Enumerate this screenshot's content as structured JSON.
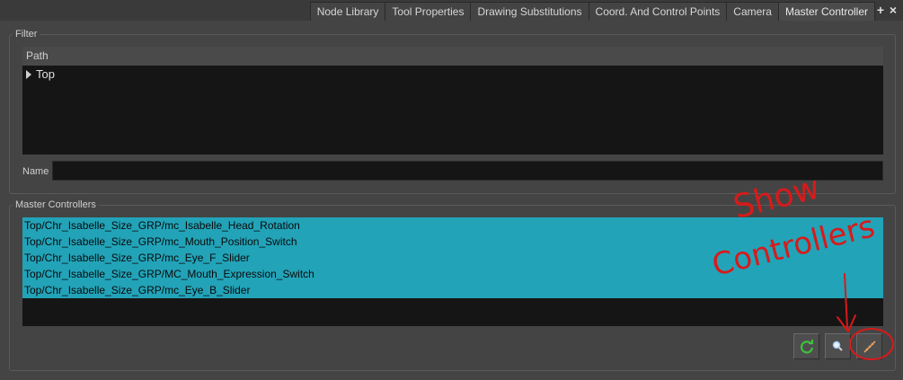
{
  "tabs": [
    {
      "label": "Node Library"
    },
    {
      "label": "Tool Properties"
    },
    {
      "label": "Drawing Substitutions"
    },
    {
      "label": "Coord. And Control Points"
    },
    {
      "label": "Camera"
    },
    {
      "label": "Master Controller",
      "active": true
    }
  ],
  "tab_controls": {
    "add_icon": "plus-icon",
    "close_icon": "close-icon"
  },
  "filter": {
    "title": "Filter",
    "tree_header": "Path",
    "tree_root": "Top",
    "name_label": "Name",
    "name_value": ""
  },
  "master_controllers": {
    "title": "Master Controllers",
    "items": [
      "Top/Chr_Isabelle_Size_GRP/mc_Isabelle_Head_Rotation",
      "Top/Chr_Isabelle_Size_GRP/mc_Mouth_Position_Switch",
      "Top/Chr_Isabelle_Size_GRP/mc_Eye_F_Slider",
      "Top/Chr_Isabelle_Size_GRP/MC_Mouth_Expression_Switch",
      "Top/Chr_Isabelle_Size_GRP/mc_Eye_B_Slider"
    ]
  },
  "toolbar": {
    "refresh_icon": "refresh-icon",
    "search_icon": "magnifier-icon",
    "show_controllers_icon": "show-controllers-icon"
  },
  "annotation": {
    "line1": "Show",
    "line2": "Controllers",
    "color": "#d81a1a"
  },
  "colors": {
    "selection": "#22a3b8",
    "panel": "#444444",
    "tree_bg": "#151515"
  }
}
